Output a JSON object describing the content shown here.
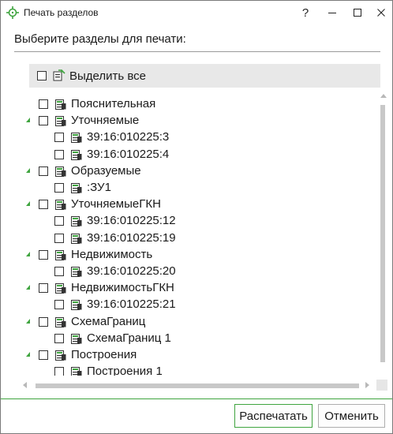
{
  "window": {
    "title": "Печать разделов",
    "help_label": "?"
  },
  "dialog": {
    "prompt": "Выберите разделы для печати:"
  },
  "select_all": {
    "label": "Выделить все",
    "checked": false
  },
  "tree": {
    "items": [
      {
        "label": "Пояснительная",
        "level": 0,
        "expandable": false
      },
      {
        "label": "Уточняемые",
        "level": 0,
        "expandable": true
      },
      {
        "label": "39:16:010225:3",
        "level": 1,
        "expandable": false
      },
      {
        "label": "39:16:010225:4",
        "level": 1,
        "expandable": false
      },
      {
        "label": "Образуемые",
        "level": 0,
        "expandable": true
      },
      {
        "label": ":ЗУ1",
        "level": 1,
        "expandable": false
      },
      {
        "label": "УточняемыеГКН",
        "level": 0,
        "expandable": true
      },
      {
        "label": "39:16:010225:12",
        "level": 1,
        "expandable": false
      },
      {
        "label": "39:16:010225:19",
        "level": 1,
        "expandable": false
      },
      {
        "label": "Недвижимость",
        "level": 0,
        "expandable": true
      },
      {
        "label": "39:16:010225:20",
        "level": 1,
        "expandable": false
      },
      {
        "label": "НедвижимостьГКН",
        "level": 0,
        "expandable": true
      },
      {
        "label": "39:16:010225:21",
        "level": 1,
        "expandable": false
      },
      {
        "label": "СхемаГраниц",
        "level": 0,
        "expandable": true
      },
      {
        "label": "СхемаГраниц 1",
        "level": 1,
        "expandable": false
      },
      {
        "label": "Построения",
        "level": 0,
        "expandable": true
      },
      {
        "label": "Построения 1",
        "level": 1,
        "expandable": false
      }
    ]
  },
  "buttons": {
    "print_label": "Распечатать",
    "cancel_label": "Отменить"
  },
  "colors": {
    "accent": "#3fa43f",
    "select_all_bg": "#e8e8e8"
  },
  "icons": [
    "crosshair-app-icon",
    "help-icon",
    "minimize-icon",
    "maximize-icon",
    "close-icon",
    "select-all-icon",
    "section-icon",
    "expand-arrow-icon"
  ]
}
